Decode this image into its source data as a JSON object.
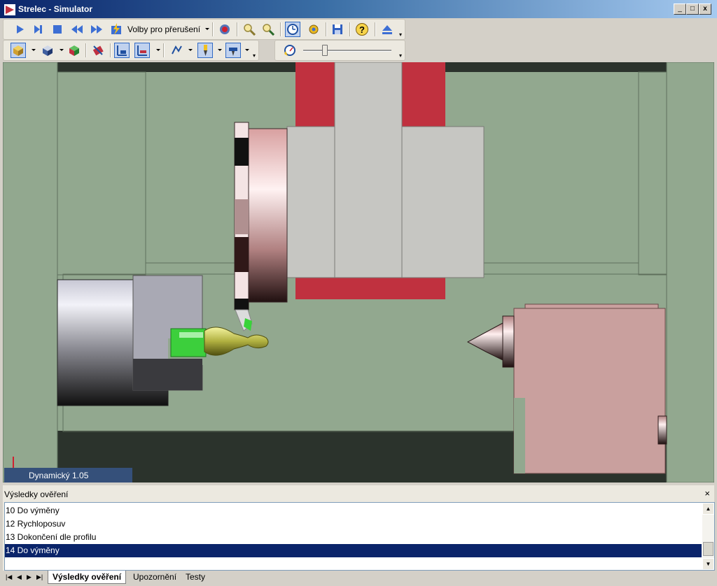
{
  "window": {
    "title": "Strelec - Simulator"
  },
  "toolbar": {
    "interrupt_dropdown_label": "Volby pro přerušení"
  },
  "viewport": {
    "mode_label": "Dynamický 1.05"
  },
  "results_panel": {
    "title": "Výsledky ověření",
    "close_glyph": "×",
    "rows": [
      "10 Do výměny",
      "12 Rychloposuv",
      "13 Dokončení dle profilu",
      "14 Do výměny"
    ],
    "selected_row": "14 Do výměny"
  },
  "tabs": [
    "Výsledky ověření",
    "Upozornění",
    "Testy"
  ],
  "colors": {
    "viewport_bg": "#92a88f",
    "selection": "#0a246a",
    "chuck_red": "#c0313f",
    "tailstock": "#c9a09e"
  }
}
